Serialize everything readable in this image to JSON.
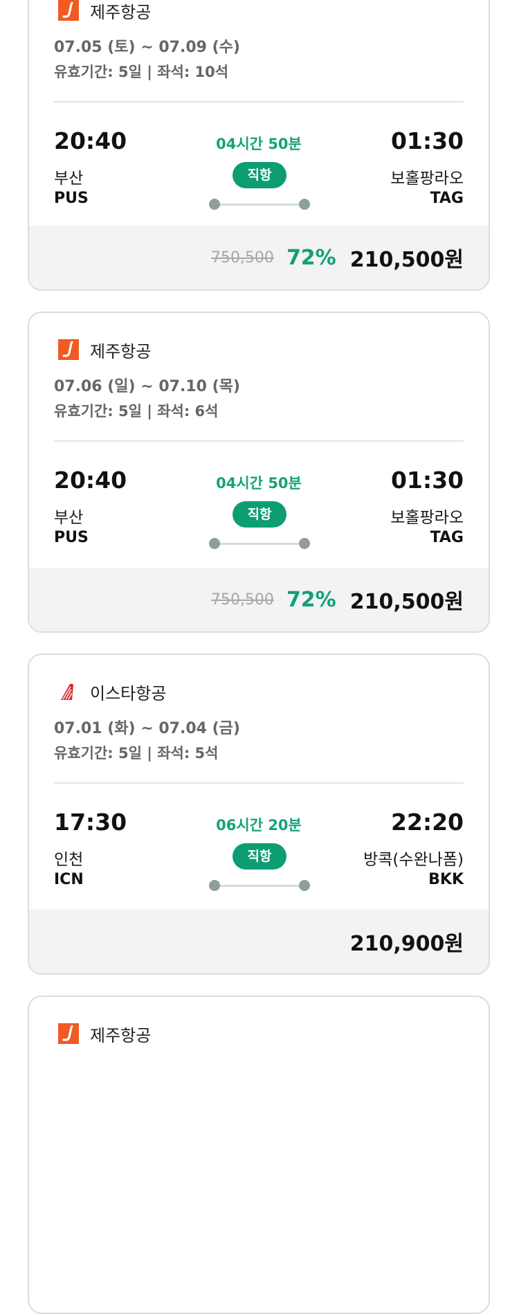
{
  "currency_suffix": "원",
  "cards": [
    {
      "airline": "제주항공",
      "logo": "jeju-air-logo",
      "dates": "07.05 (토) ~ 07.09 (수)",
      "validity": "유효기간: 5일 | 좌석: 10석",
      "departure": {
        "time": "20:40",
        "city": "부산",
        "code": "PUS"
      },
      "arrival": {
        "time": "01:30",
        "city": "보홀팡라오",
        "code": "TAG"
      },
      "duration": "04시간 50분",
      "direct": "직항",
      "original_price": "750,500",
      "discount": "72%",
      "price": "210,500원"
    },
    {
      "airline": "제주항공",
      "logo": "jeju-air-logo",
      "dates": "07.06 (일) ~ 07.10 (목)",
      "validity": "유효기간: 5일 | 좌석: 6석",
      "departure": {
        "time": "20:40",
        "city": "부산",
        "code": "PUS"
      },
      "arrival": {
        "time": "01:30",
        "city": "보홀팡라오",
        "code": "TAG"
      },
      "duration": "04시간 50분",
      "direct": "직항",
      "original_price": "750,500",
      "discount": "72%",
      "price": "210,500원"
    },
    {
      "airline": "이스타항공",
      "logo": "eastar-jet-logo",
      "dates": "07.01 (화) ~ 07.04 (금)",
      "validity": "유효기간: 5일 | 좌석: 5석",
      "departure": {
        "time": "17:30",
        "city": "인천",
        "code": "ICN"
      },
      "arrival": {
        "time": "22:20",
        "city": "방콕(수완나폼)",
        "code": "BKK"
      },
      "duration": "06시간 20분",
      "direct": "직항",
      "original_price": "",
      "discount": "",
      "price": "210,900원"
    },
    {
      "airline": "제주항공",
      "logo": "jeju-air-logo"
    }
  ],
  "colors": {
    "accent_green": "#0c9d72",
    "discount_green": "#13a07a",
    "jeju_orange": "#f15a22",
    "eastar_red": "#d9232f",
    "price_bar_bg": "#f3f3f3"
  }
}
